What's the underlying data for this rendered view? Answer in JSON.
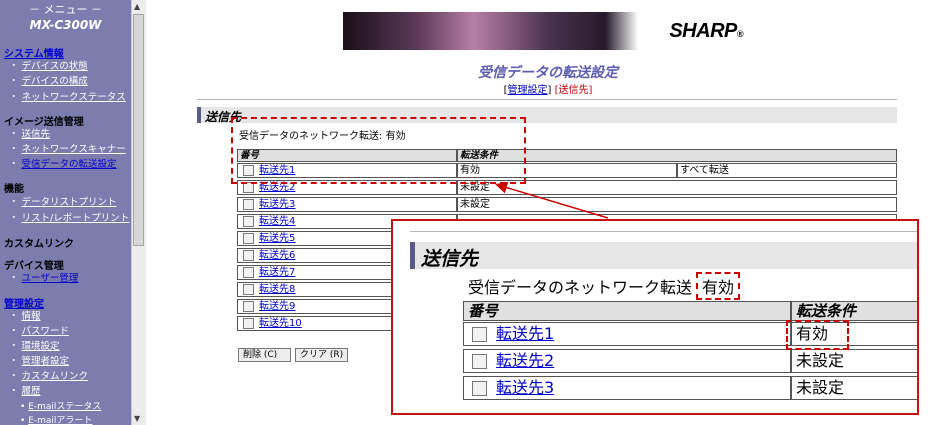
{
  "sidebar": {
    "menu_title": "－ メニュー －",
    "model": "MX-C300W",
    "sections": {
      "system_info": "システム情報",
      "device_status": "デバイスの状態",
      "device_config": "デバイスの構成",
      "network_status": "ネットワークステータス",
      "image_send": "イメージ送信管理",
      "send_dest": "送信先",
      "network_scanner": "ネットワークスキャナー",
      "rx_forward": "受信データの転送設定",
      "function": "機能",
      "data_list_print": "データリストプリント",
      "list_report_print": "リスト/レポートプリント",
      "custom_link": "カスタムリンク",
      "device_mgmt": "デバイス管理",
      "user_mgmt": "ユーザー管理",
      "admin_settings": "管理設定",
      "info": "情報",
      "password": "パスワード",
      "env_settings": "環境設定",
      "admin_config": "管理者設定",
      "custom_link2": "カスタムリンク",
      "history": "履歴",
      "email_status": "E-mailステータス",
      "email_alert": "E-mailアラート"
    }
  },
  "header": {
    "logo": "SHARP",
    "logo_mark": "®",
    "title": "受信データの転送設定",
    "link_admin": "管理設定",
    "link_dest": "送信先"
  },
  "section": {
    "title": "送信先",
    "network_label": "受信データのネットワーク転送",
    "network_value": "有効"
  },
  "table": {
    "col_number": "番号",
    "col_condition": "転送条件",
    "rows": [
      {
        "name": "転送先1",
        "cond": "有効",
        "extra": "すべて転送"
      },
      {
        "name": "転送先2",
        "cond": "未設定"
      },
      {
        "name": "転送先3",
        "cond": "未設定"
      },
      {
        "name": "転送先4",
        "cond": ""
      },
      {
        "name": "転送先5",
        "cond": ""
      },
      {
        "name": "転送先6",
        "cond": ""
      },
      {
        "name": "転送先7",
        "cond": ""
      },
      {
        "name": "転送先8",
        "cond": ""
      },
      {
        "name": "転送先9",
        "cond": ""
      },
      {
        "name": "転送先10",
        "cond": ""
      }
    ]
  },
  "buttons": {
    "delete": "削除 (C)",
    "clear": "クリア (R)"
  },
  "colors": {
    "sidebar_bg": "#7c7cae",
    "highlight": "#cc0000",
    "title": "#5b5bb0",
    "link": "#0000cc"
  }
}
